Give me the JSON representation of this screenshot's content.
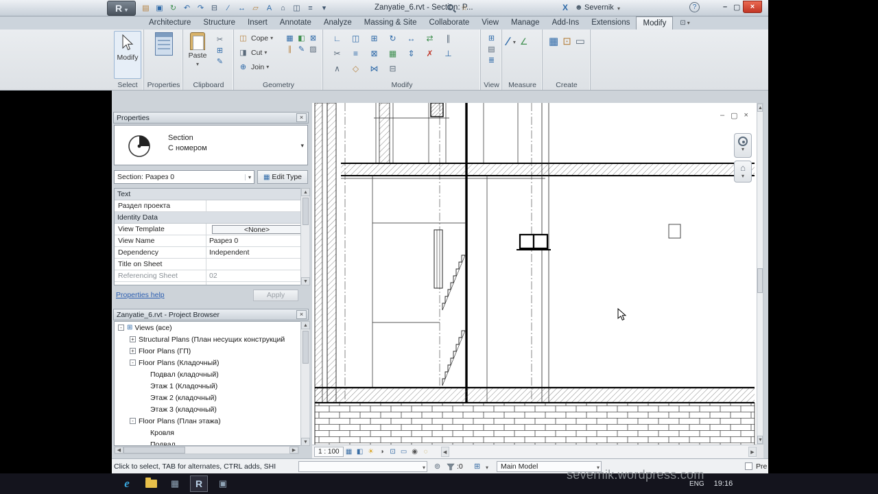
{
  "colors": {
    "close_red": "#c9402f",
    "accent_blue": "#3a6ea5",
    "taskbar_dark": "#14141d"
  },
  "icons": {
    "app_logo": "R",
    "open": "▤",
    "save": "▣",
    "sync": "↻",
    "undo": "↶",
    "redo": "↷",
    "print": "⊟",
    "measure": "∕",
    "aligned_dim": "↔",
    "tag": "▱",
    "text": "A",
    "default_3d": "⌂",
    "section": "◫",
    "thin_lines": "≡",
    "dropdown": "▾",
    "star": "☆",
    "exchange": "X",
    "user": "☻",
    "help": "?",
    "minimize": "–",
    "restore": "▢",
    "close": "×",
    "cut_small": "✂",
    "copy_small": "⊞",
    "match_small": "✎",
    "cope": "◫",
    "cut_geo": "◨",
    "join": "⊕",
    "g1": "▦",
    "g2": "◧",
    "g3": "⊠",
    "g4": "∥",
    "g5": "✎",
    "g6": "▨",
    "m1": "∟",
    "m2": "◫",
    "m3": "⊞",
    "m4": "↻",
    "m5": "↔",
    "m6": "⇄",
    "m7": "∥",
    "m8": "✂",
    "m9": "≡",
    "m10": "⊠",
    "m11": "▦",
    "m12": "⇕",
    "m13": "✗",
    "m14": "⊥",
    "m15": "∧",
    "m16": "◇",
    "m17": "⋈",
    "m18": "⊟",
    "v1": "⊞",
    "v2": "▤",
    "v3": "≣",
    "me1": "∕",
    "me2": "∠",
    "c1": "▦",
    "c2": "⊡",
    "c3": "▭",
    "ribbon_toggle": "⊡",
    "nav_min": "–",
    "nav_restore": "▢",
    "nav_close": "×",
    "cube": "⌂",
    "vb_detail": "▦",
    "vb_style": "◧",
    "vb_sun": "☀",
    "vb_shadow": "◑",
    "vb_crop": "⊡",
    "vb_showcrop": "▭",
    "vb_hide": "◉",
    "vb_reveal": "◌",
    "arrow_left": "◀",
    "arrow_right": "▶",
    "arrow_up": "▲",
    "arrow_down": "▼",
    "tree_views": "⊞",
    "worksets": "⊚",
    "design_options": "⊞",
    "edit_type": "▦",
    "chevrons": "∧"
  },
  "title_bar": {
    "title": "Zanyatie_6.rvt - Section: P...",
    "user_name": "Severnik"
  },
  "ribbon": {
    "tabs": [
      "Architecture",
      "Structure",
      "Insert",
      "Annotate",
      "Analyze",
      "Massing & Site",
      "Collaborate",
      "View",
      "Manage",
      "Add-Ins",
      "Extensions",
      "Modify"
    ],
    "active_tab": "Modify",
    "panels": {
      "select": "Select",
      "properties": "Properties",
      "clipboard": "Clipboard",
      "geometry": "Geometry",
      "modify": "Modify",
      "view": "View",
      "measure": "Measure",
      "create": "Create"
    },
    "buttons": {
      "modify": "Modify",
      "paste": "Paste",
      "cope": "Cope",
      "cut": "Cut",
      "join": "Join"
    }
  },
  "properties_panel": {
    "header": "Properties",
    "type_label": "Section",
    "type_name": "С номером",
    "instance_selector": "Section: Разрез 0",
    "edit_type": "Edit Type",
    "groups": {
      "text": "Text",
      "identity": "Identity Data"
    },
    "rows": [
      {
        "label": "Раздел проекта",
        "value": ""
      },
      {
        "label": "View Template",
        "value": "<None>"
      },
      {
        "label": "View Name",
        "value": "Разрез 0"
      },
      {
        "label": "Dependency",
        "value": "Independent"
      },
      {
        "label": "Title on Sheet",
        "value": ""
      },
      {
        "label": "Referencing Sheet",
        "value": "02"
      }
    ],
    "help_link": "Properties help",
    "apply": "Apply"
  },
  "project_browser": {
    "header": "Zanyatie_6.rvt - Project Browser",
    "items": [
      {
        "toggle": "-",
        "label": "Views (все)"
      },
      {
        "toggle": "+",
        "label": "Structural Plans (План несущих конструкций"
      },
      {
        "toggle": "+",
        "label": "Floor Plans (ГП)"
      },
      {
        "toggle": "-",
        "label": "Floor Plans (Кладочный)"
      },
      {
        "toggle": "",
        "label": "Подвал (кладочный)"
      },
      {
        "toggle": "",
        "label": "Этаж 1 (Кладочный)"
      },
      {
        "toggle": "",
        "label": "Этаж 2 (кладочный)"
      },
      {
        "toggle": "",
        "label": "Этаж 3 (кладочный)"
      },
      {
        "toggle": "-",
        "label": "Floor Plans (План этажа)"
      },
      {
        "toggle": "",
        "label": "Кровля"
      },
      {
        "toggle": "",
        "label": "Подвал"
      }
    ]
  },
  "view_bar": {
    "scale": "1 : 100"
  },
  "status_bar": {
    "prompt": "Click to select, TAB for alternates, CTRL adds, SHI",
    "selection_count": ":0",
    "design_option": "Main Model",
    "right_label": "Pre"
  },
  "taskbar": {
    "language": "ENG",
    "time": "19:16"
  },
  "watermark": "severnik.wordpress.com"
}
